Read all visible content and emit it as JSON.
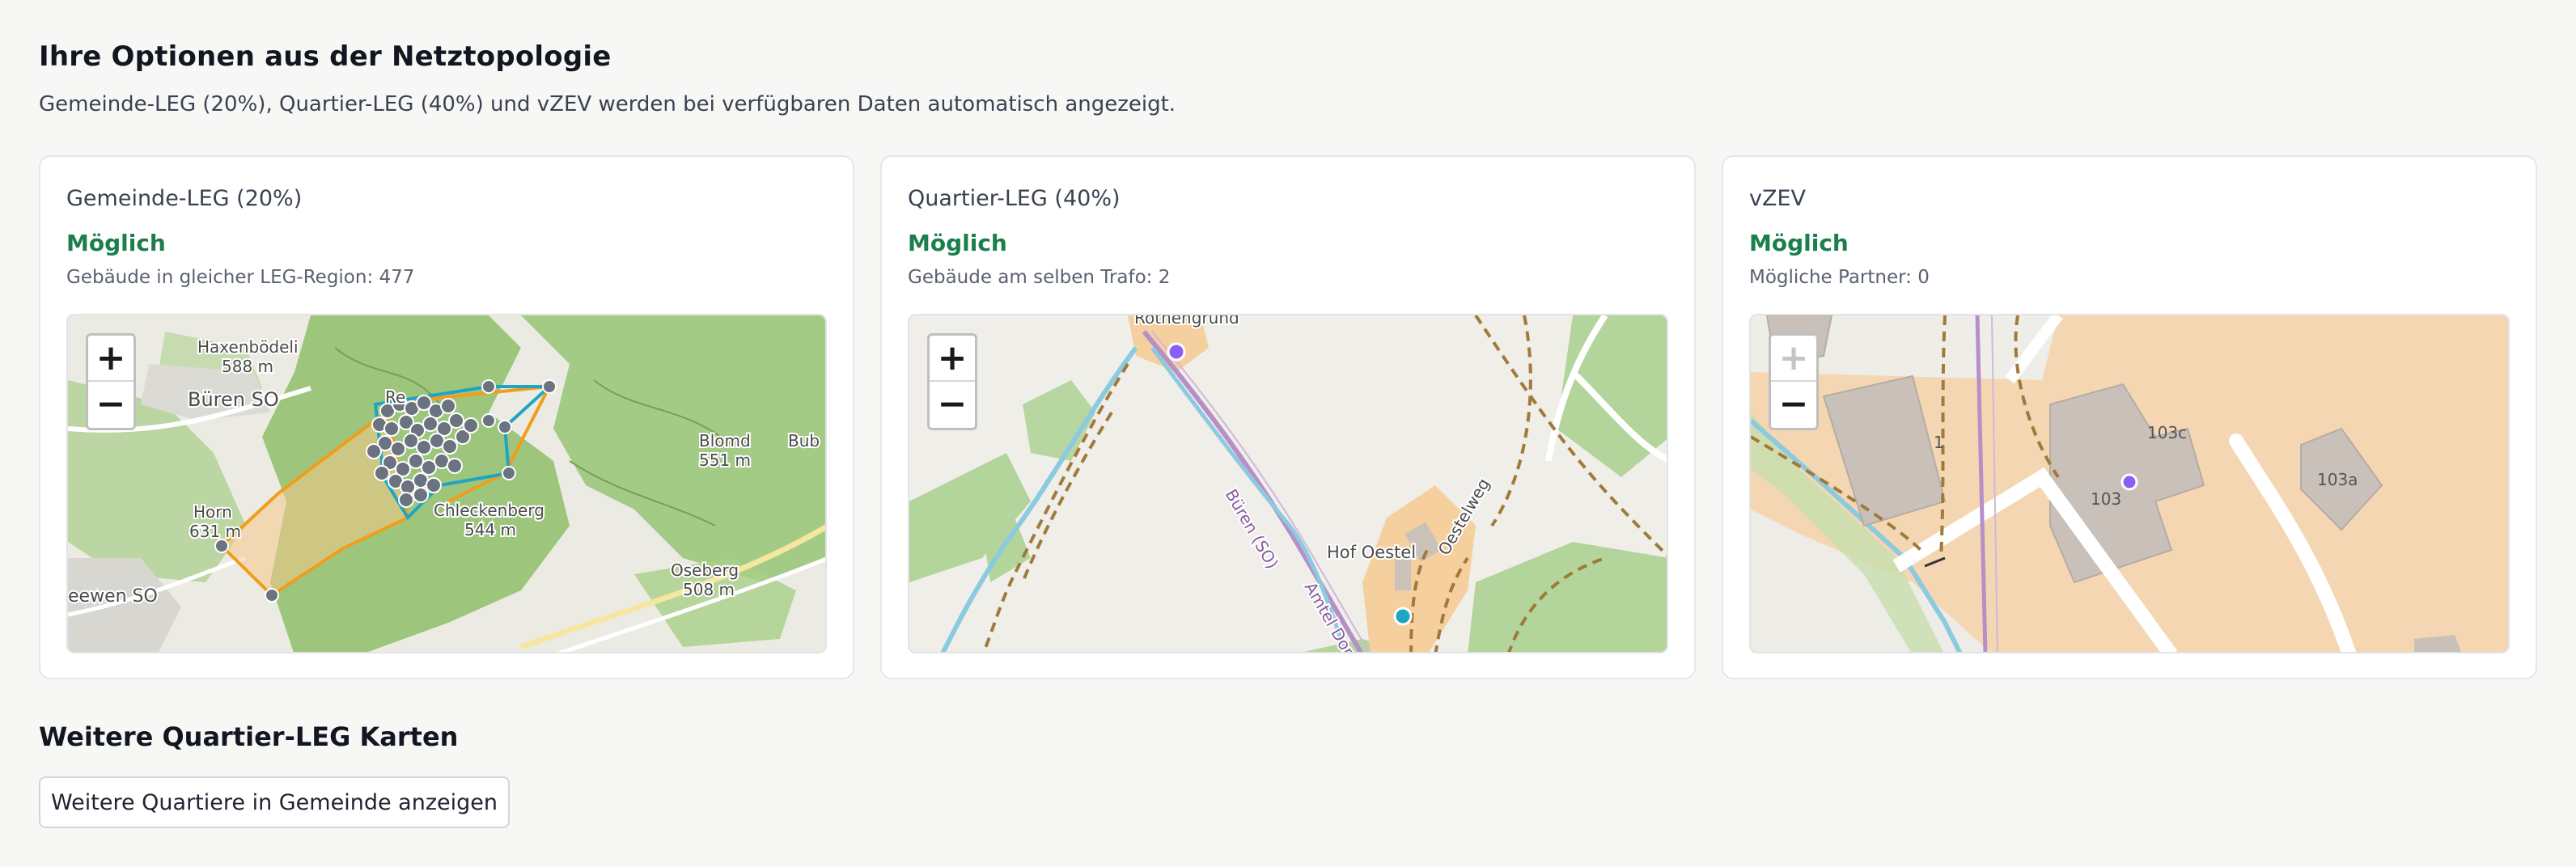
{
  "section": {
    "title": "Ihre Optionen aus der Netztopologie",
    "description": "Gemeinde-LEG (20%), Quartier-LEG (40%) und vZEV werden bei verfügbaren Daten automatisch angezeigt."
  },
  "cards": [
    {
      "title": "Gemeinde-LEG (20%)",
      "status": "Möglich",
      "meta": "Gebäude in gleicher LEG-Region: 477",
      "map_labels": {
        "haxen": "Haxenbödeli",
        "haxen_elev": "588 m",
        "bueren": "Büren SO",
        "horn": "Horn",
        "horn_elev": "631 m",
        "blomd": "Blomd",
        "blomd_elev": "551 m",
        "bub": "Bub",
        "chleck": "Chleckenberg",
        "chleck_elev": "544 m",
        "oseh": "Oseberg",
        "oseh_elev": "508 m",
        "seewen": "eewen SO",
        "re": "Re"
      }
    },
    {
      "title": "Quartier-LEG (40%)",
      "status": "Möglich",
      "meta": "Gebäude am selben Trafo: 2",
      "map_labels": {
        "rothen": "Rothengrund",
        "bueren_so": "Büren (SO)",
        "hof": "Hof Oestel",
        "oestelweg": "Oestelweg",
        "amtel": "Amtel Dor"
      }
    },
    {
      "title": "vZEV",
      "status": "Möglich",
      "meta": "Mögliche Partner: 0",
      "map_labels": {
        "b1": "1",
        "b103": "103",
        "b103c": "103c",
        "b103a": "103a"
      }
    }
  ],
  "zoom": {
    "in": "+",
    "out": "−"
  },
  "more": {
    "title": "Weitere Quartier-LEG Karten",
    "button": "Weitere Quartiere in Gemeinde anzeigen"
  },
  "colors": {
    "status_green": "#1a7f4b",
    "polygon_orange": "#f29d1a",
    "polygon_cyan": "#1fa5c4",
    "building_dot": "#6b7280",
    "partner_dot": "#8b5cf6"
  }
}
